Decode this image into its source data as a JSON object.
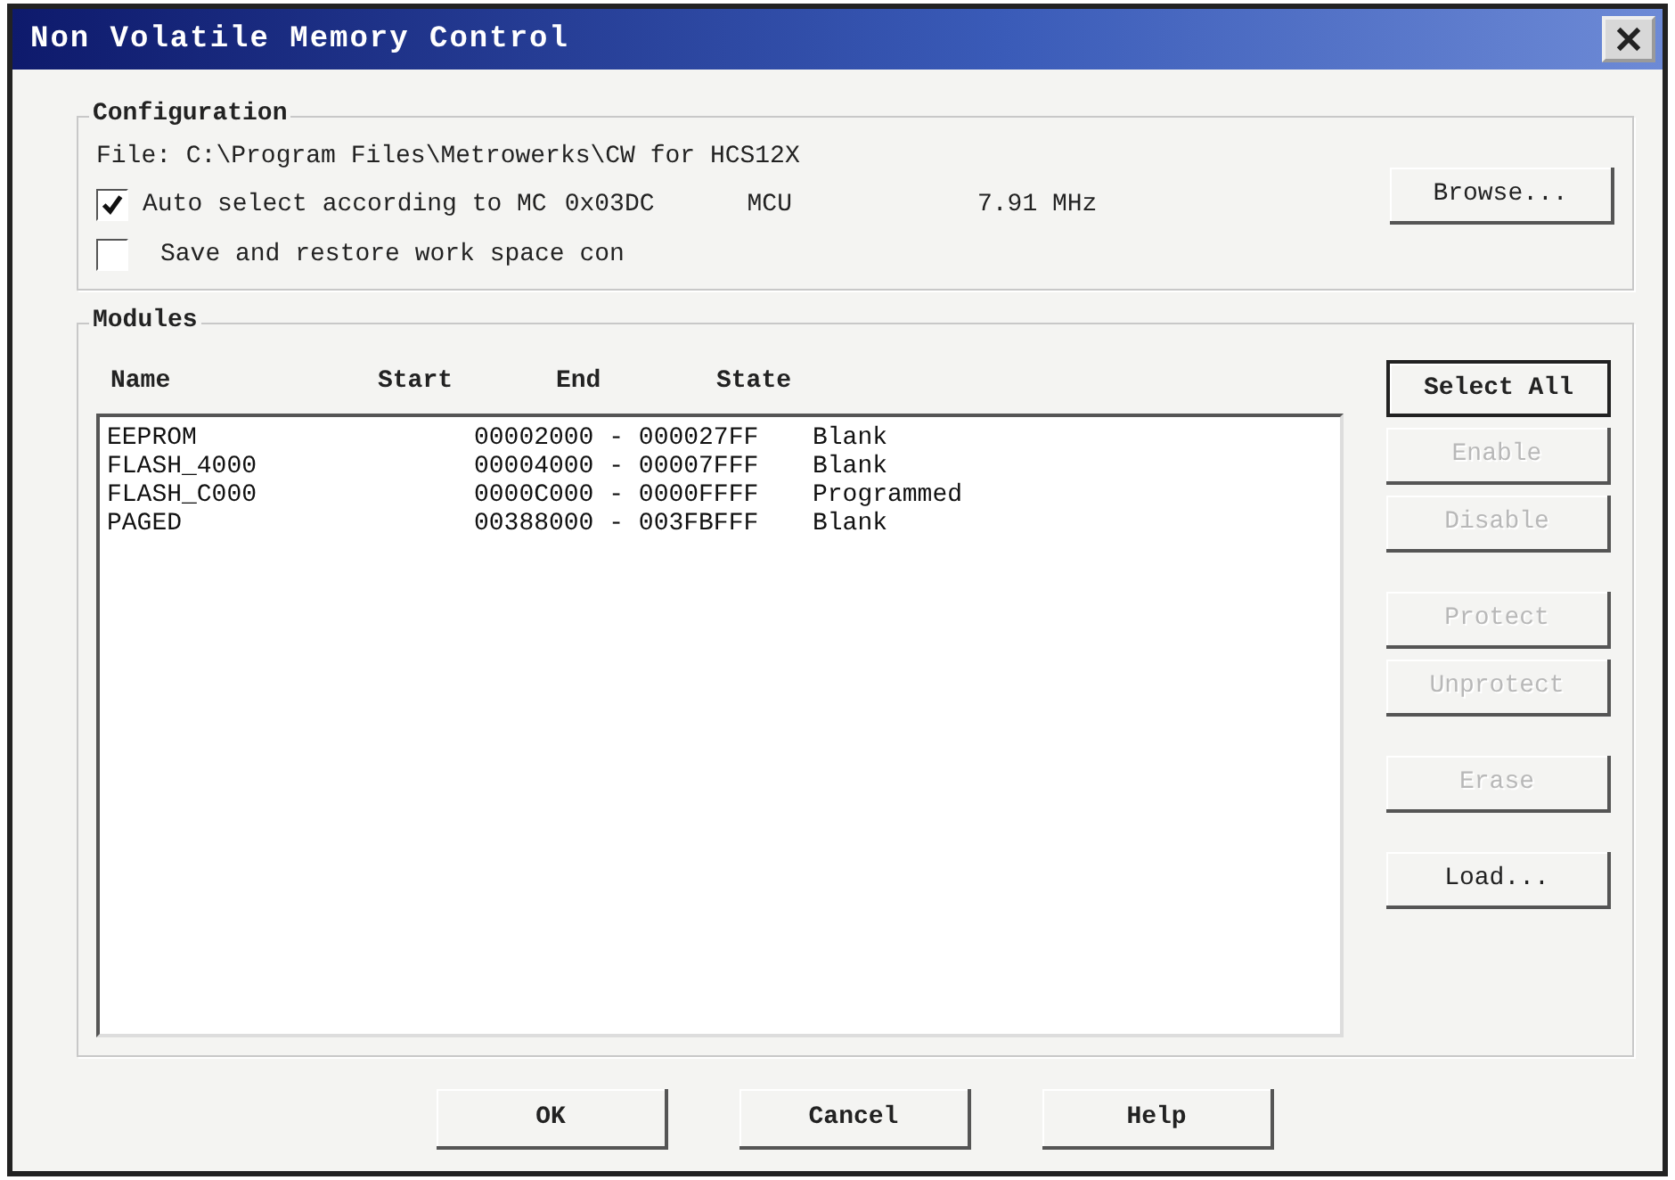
{
  "window": {
    "title": "Non Volatile Memory Control"
  },
  "configuration": {
    "title": "Configuration",
    "file_label": "File: C:\\Program Files\\Metrowerks\\CW for HCS12X",
    "auto_select": {
      "label": "Auto select according to MC",
      "checked": true
    },
    "mcu_id": "0x03DC",
    "mcu_label": "MCU",
    "frequency": "7.91 MHz",
    "save_restore": {
      "label": "Save and restore work space con",
      "checked": false
    },
    "browse_button": "Browse..."
  },
  "modules": {
    "title": "Modules",
    "columns": [
      "Name",
      "Start",
      "End",
      "State"
    ],
    "rows": [
      {
        "name": "EEPROM",
        "range": "00002000 - 000027FF",
        "state": "Blank"
      },
      {
        "name": "FLASH_4000",
        "range": "00004000 - 00007FFF",
        "state": "Blank"
      },
      {
        "name": "FLASH_C000",
        "range": "0000C000 - 0000FFFF",
        "state": "Programmed"
      },
      {
        "name": "PAGED",
        "range": "00388000 - 003FBFFF",
        "state": "Blank"
      }
    ],
    "button_groups": [
      [
        {
          "label": "Select All",
          "disabled": false,
          "default": true
        },
        {
          "label": "Enable",
          "disabled": true,
          "default": false
        },
        {
          "label": "Disable",
          "disabled": true,
          "default": false
        }
      ],
      [
        {
          "label": "Protect",
          "disabled": true,
          "default": false
        },
        {
          "label": "Unprotect",
          "disabled": true,
          "default": false
        }
      ],
      [
        {
          "label": "Erase",
          "disabled": true,
          "default": false
        }
      ],
      [
        {
          "label": "Load...",
          "disabled": false,
          "default": false
        }
      ]
    ]
  },
  "buttons": [
    "OK",
    "Cancel",
    "Help"
  ]
}
